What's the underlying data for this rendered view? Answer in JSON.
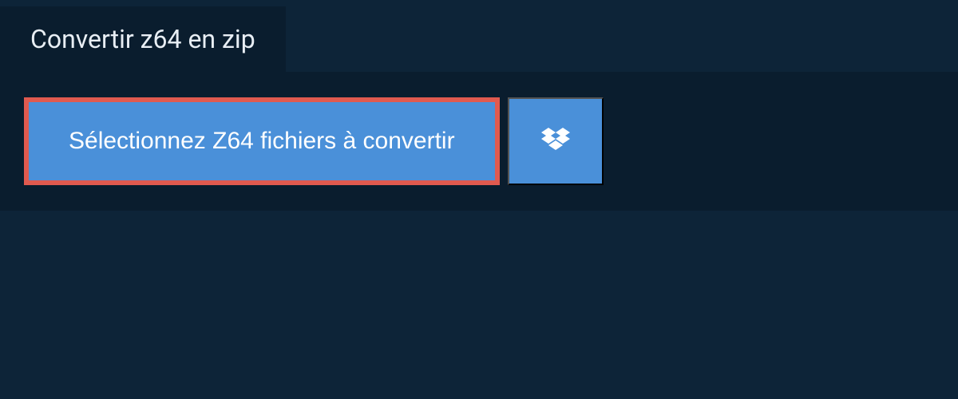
{
  "header": {
    "title": "Convertir z64 en zip"
  },
  "actions": {
    "select_label": "Sélectionnez Z64 fichiers à convertir",
    "dropbox_label": "Dropbox"
  },
  "colors": {
    "background": "#0d2438",
    "panel": "#0a1d2e",
    "button": "#4a90d9",
    "highlight_border": "#e05a4f",
    "text": "#ffffff"
  }
}
